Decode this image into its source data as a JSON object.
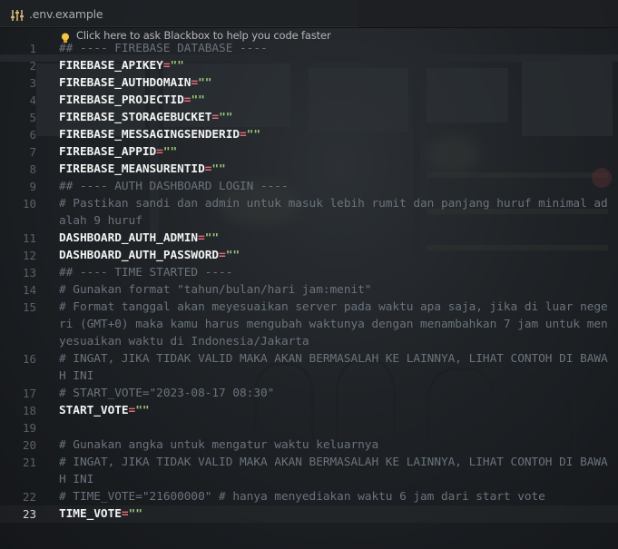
{
  "tab": {
    "title": ".env.example",
    "icon": "settings-sliders-icon"
  },
  "hint": {
    "text": "Click here to ask Blackbox to help you code faster",
    "icon": "lightbulb-icon"
  },
  "colors": {
    "key": "#f2f2f2",
    "equals": "#e06c75",
    "string": "#98c379",
    "comment": "#6a737d",
    "line_number": "#5b6067"
  },
  "editor": {
    "active_line": "23",
    "lines": [
      {
        "num": "1",
        "kind": "comment",
        "text": "## ---- FIREBASE DATABASE ----"
      },
      {
        "num": "2",
        "kind": "kv",
        "key": "FIREBASE_APIKEY",
        "eq": "=",
        "val": "\"\""
      },
      {
        "num": "3",
        "kind": "kv",
        "key": "FIREBASE_AUTHDOMAIN",
        "eq": "=",
        "val": "\"\""
      },
      {
        "num": "4",
        "kind": "kv",
        "key": "FIREBASE_PROJECTID",
        "eq": "=",
        "val": "\"\""
      },
      {
        "num": "5",
        "kind": "kv",
        "key": "FIREBASE_STORAGEBUCKET",
        "eq": "=",
        "val": "\"\""
      },
      {
        "num": "6",
        "kind": "kv",
        "key": "FIREBASE_MESSAGINGSENDERID",
        "eq": "=",
        "val": "\"\""
      },
      {
        "num": "7",
        "kind": "kv",
        "key": "FIREBASE_APPID",
        "eq": "=",
        "val": "\"\""
      },
      {
        "num": "8",
        "kind": "kv",
        "key": "FIREBASE_MEANSURENTID",
        "eq": "=",
        "val": "\"\""
      },
      {
        "num": "9",
        "kind": "comment",
        "text": "## ---- AUTH DASHBOARD LOGIN ----"
      },
      {
        "num": "10",
        "kind": "comment",
        "text": "# Pastikan sandi dan admin untuk masuk lebih rumit dan panjang huruf minimal adalah 9 huruf",
        "rows": 2
      },
      {
        "num": "11",
        "kind": "kv",
        "key": "DASHBOARD_AUTH_ADMIN",
        "eq": "=",
        "val": "\"\""
      },
      {
        "num": "12",
        "kind": "kv",
        "key": "DASHBOARD_AUTH_PASSWORD",
        "eq": "=",
        "val": "\"\""
      },
      {
        "num": "13",
        "kind": "comment",
        "text": "## ---- TIME STARTED ----"
      },
      {
        "num": "14",
        "kind": "comment",
        "text": "# Gunakan format \"tahun/bulan/hari jam:menit\""
      },
      {
        "num": "15",
        "kind": "comment",
        "text": "# Format tanggal akan meyesuaikan server pada waktu apa saja, jika di luar negeri (GMT+0) maka kamu harus mengubah waktunya dengan menambahkan 7 jam untuk menyesuaikan waktu di Indonesia/Jakarta",
        "rows": 3
      },
      {
        "num": "16",
        "kind": "comment",
        "text": "# INGAT, JIKA TIDAK VALID MAKA AKAN BERMASALAH KE LAINNYA, LIHAT CONTOH DI BAWAH INI",
        "rows": 2
      },
      {
        "num": "17",
        "kind": "comment",
        "text": "# START_VOTE=\"2023-08-17 08:30\""
      },
      {
        "num": "18",
        "kind": "kv",
        "key": "START_VOTE",
        "eq": "=",
        "val": "\"\""
      },
      {
        "num": "19",
        "kind": "blank",
        "text": ""
      },
      {
        "num": "20",
        "kind": "comment",
        "text": "# Gunakan angka untuk mengatur waktu keluarnya"
      },
      {
        "num": "21",
        "kind": "comment",
        "text": "# INGAT, JIKA TIDAK VALID MAKA AKAN BERMASALAH KE LAINNYA, LIHAT CONTOH DI BAWAH INI",
        "rows": 2
      },
      {
        "num": "22",
        "kind": "comment",
        "text": "# TIME_VOTE=\"21600000\" # hanya menyediakan waktu 6 jam dari start vote"
      },
      {
        "num": "23",
        "kind": "kv",
        "key": "TIME_VOTE",
        "eq": "=",
        "val": "\"\""
      }
    ]
  }
}
